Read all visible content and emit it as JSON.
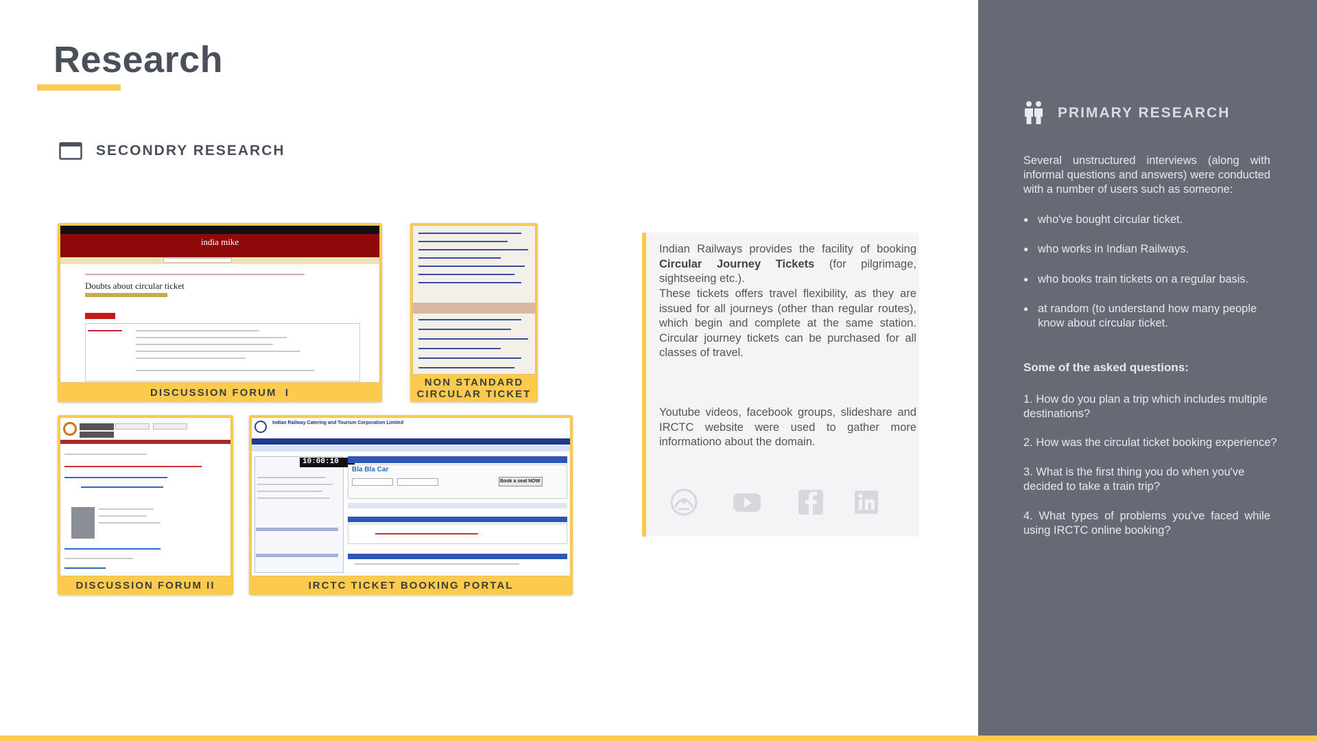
{
  "page": {
    "title": "Research"
  },
  "secondary": {
    "heading": "SECONDRY RESEARCH",
    "cards": {
      "forum1": {
        "caption": "DISCUSSION FORUM  I",
        "site_title": "india mike",
        "post_title": "Doubts about circular ticket"
      },
      "ticket": {
        "caption_line1": "NON STANDARD",
        "caption_line2": "CIRCULAR TICKET"
      },
      "forum2": {
        "caption": "DISCUSSION FORUM II"
      },
      "irctc": {
        "caption": "IRCTC TICKET BOOKING PORTAL",
        "site_title": "Indian Railway Catering and Tourism Corporation Limited",
        "clock": "10:00:10",
        "brand": "Bla Bla Car",
        "book_button": "Book a seat NOW"
      }
    }
  },
  "info": {
    "p1_intro": "Indian Railways provides the facility of booking ",
    "p1_bold": "Circular Journey Tickets",
    "p1_rest": " (for pilgrimage, sightseeing etc.).",
    "p2": "These tickets offers travel flexibility, as they are issued for all journeys (other than regular routes), which begin and complete at the same station. Circular journey tickets can be purchased for all classes of travel.",
    "p3": "Youtube videos, facebook groups, slideshare and IRCTC website were used to gather more informationo about the domain.",
    "icons": [
      "irctc-logo-icon",
      "youtube-icon",
      "facebook-icon",
      "linkedin-icon"
    ]
  },
  "primary": {
    "heading": "PRIMARY RESEARCH",
    "intro": "Several unstructured interviews (along with informal questions and answers) were conducted with a number of users such as someone:",
    "bullets": [
      "who've bought circular ticket.",
      "who works in Indian Railways.",
      "who books train tickets on a regular basis.",
      " at random (to understand how many people know about circular ticket."
    ],
    "questions_heading": "Some of the asked questions:",
    "questions": [
      "1. How do you plan a trip which includes multiple destinations?",
      "2. How was the circulat ticket booking experience?",
      "3. What is the first thing you do when you've decided to take a train trip?",
      "4. What types of problems you've faced while using IRCTC online booking?"
    ]
  },
  "colors": {
    "accent": "#fccb4d",
    "panel": "#656a75",
    "heading": "#4a505a"
  }
}
